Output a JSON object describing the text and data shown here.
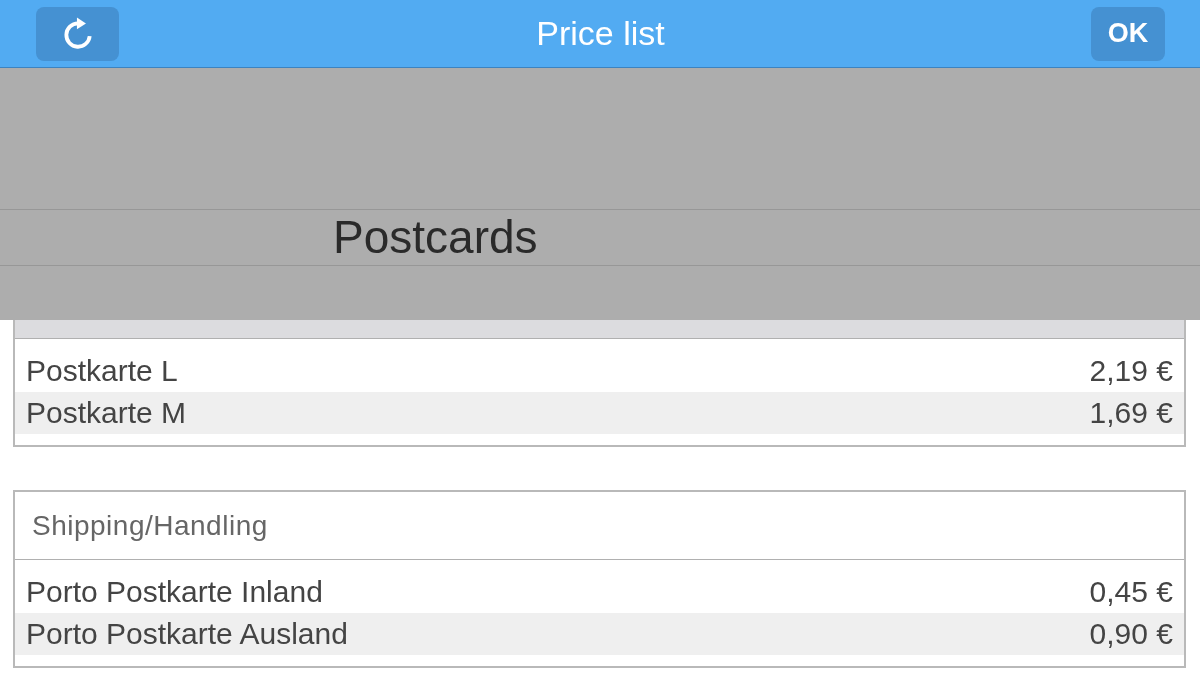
{
  "header": {
    "title": "Price list",
    "confirm_button": "OK"
  },
  "picker": {
    "options": [
      {
        "label": "Postcards",
        "selected": true
      }
    ]
  },
  "sections": [
    {
      "selected": true,
      "items": [
        {
          "name": "Postkarte L",
          "price": "2,19 €"
        },
        {
          "name": "Postkarte M",
          "price": "1,69 €"
        }
      ]
    },
    {
      "title": "Shipping/Handling",
      "selected": false,
      "items": [
        {
          "name": "Porto Postkarte Inland",
          "price": "0,45 €"
        },
        {
          "name": "Porto Postkarte Ausland",
          "price": "0,90 €"
        }
      ]
    }
  ]
}
